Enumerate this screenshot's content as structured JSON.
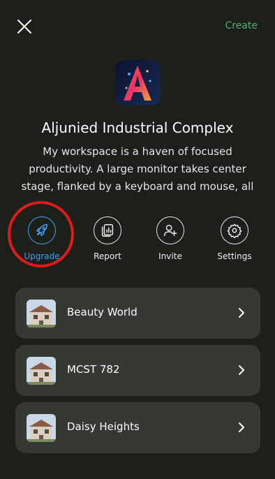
{
  "header": {
    "create_label": "Create"
  },
  "workspace": {
    "title": "Aljunied Industrial Complex",
    "description": "My workspace is a haven of focused productivity. A large monitor takes center stage, flanked by a keyboard and mouse, all r...",
    "avatar_letter": "A"
  },
  "actions": [
    {
      "label": "Upgrade",
      "icon": "rocket-icon",
      "active": true
    },
    {
      "label": "Report",
      "icon": "report-icon",
      "active": false
    },
    {
      "label": "Invite",
      "icon": "add-user-icon",
      "active": false
    },
    {
      "label": "Settings",
      "icon": "gear-icon",
      "active": false
    }
  ],
  "locations": [
    {
      "label": "Beauty World"
    },
    {
      "label": "MCST 782"
    },
    {
      "label": "Daisy Heights"
    }
  ],
  "colors": {
    "background": "#1d1f1b",
    "card": "#363833",
    "accent_green": "#4caf6f",
    "accent_blue": "#3fa0f0",
    "highlight_red": "#e01a1a"
  }
}
